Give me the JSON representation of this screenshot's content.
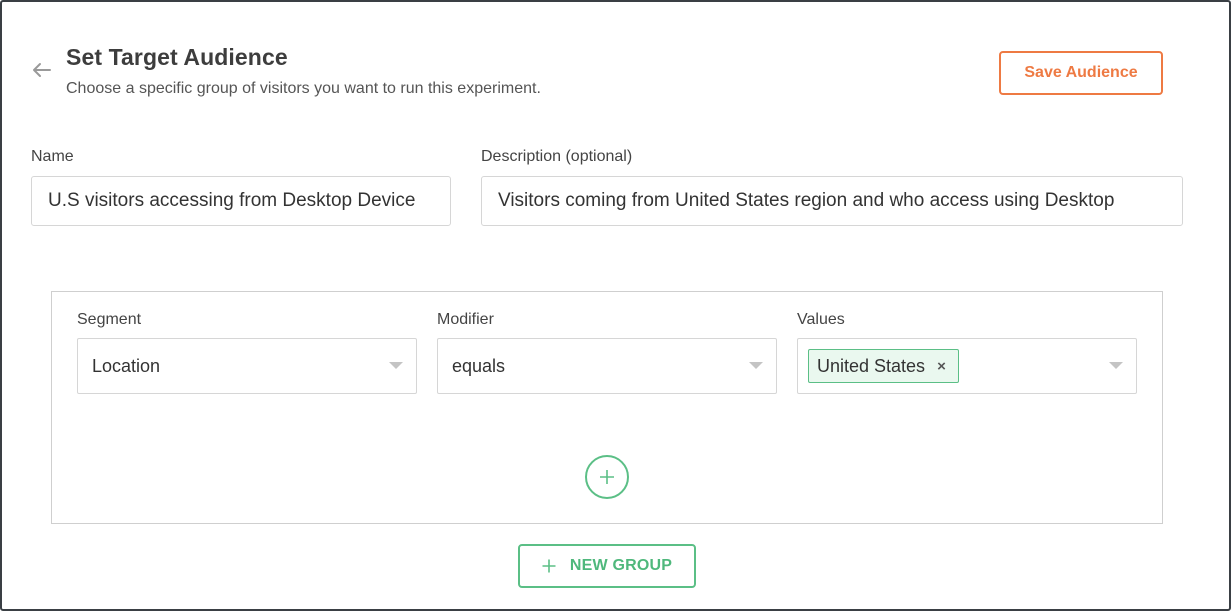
{
  "header": {
    "title": "Set Target Audience",
    "subtitle": "Choose a specific group of visitors you want to run this experiment.",
    "save_label": "Save Audience"
  },
  "form": {
    "name_label": "Name",
    "name_value": "U.S visitors accessing from Desktop Device",
    "description_label": "Description (optional)",
    "description_value": "Visitors coming from United States region and who access using Desktop"
  },
  "group": {
    "segment_label": "Segment",
    "segment_value": "Location",
    "modifier_label": "Modifier",
    "modifier_value": "equals",
    "values_label": "Values",
    "values": [
      "United States"
    ],
    "tag_remove_glyph": "×"
  },
  "new_group_label": "NEW GROUP",
  "colors": {
    "accent_orange": "#ee7a43",
    "accent_green": "#5bbf86",
    "tag_background": "#eaf8ef"
  },
  "icons": {
    "back": "arrow-left-icon",
    "add_condition": "plus-icon",
    "new_group": "plus-icon",
    "dropdown": "chevron-down-icon"
  }
}
